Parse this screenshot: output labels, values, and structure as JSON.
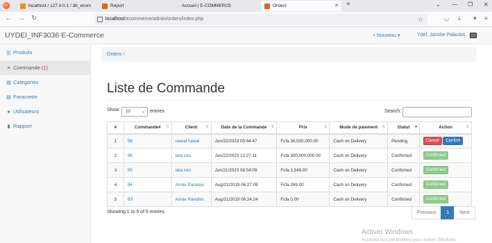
{
  "browser": {
    "tabs": [
      {
        "title": "localhost / 127.0.0.1 / db_ecom",
        "active": false
      },
      {
        "title": "Report",
        "active": false
      },
      {
        "title": "Accueil | E-COMMERCE",
        "active": false
      },
      {
        "title": "Orders",
        "active": true
      }
    ],
    "url_host": "localhost",
    "url_path": "/ecommerce/admin/orders/index.php"
  },
  "header": {
    "brand": "UYDEI_INF3036 E-Commerce",
    "nouveau": "+ Nouveau ▾",
    "user": "Ydel, Janobe Palacios"
  },
  "sidebar": {
    "items": [
      {
        "label": "Produits",
        "icon": "bars-icon",
        "glyph": "|||"
      },
      {
        "label": "Commande",
        "count": "(1)",
        "icon": "list-icon",
        "glyph": "≡"
      },
      {
        "label": "Categories",
        "icon": "list-alt-icon",
        "glyph": "▤"
      },
      {
        "label": "Parametre",
        "icon": "list-alt-icon",
        "glyph": "▤"
      },
      {
        "label": "Utilisateurs",
        "icon": "user-icon",
        "glyph": "●"
      },
      {
        "label": "Rapport",
        "icon": "report-icon",
        "glyph": "▮"
      }
    ]
  },
  "breadcrumb": {
    "link": "Orders",
    "sep": " /"
  },
  "page_title": "Liste de Commande",
  "controls": {
    "show": "Show",
    "page_size": "10",
    "entries": "entries",
    "search_label": "Search:"
  },
  "table": {
    "headers": [
      "#",
      "Commande#",
      "Client",
      "Date de la Commande",
      "Prix",
      "Mode de paiement",
      "Statut",
      "Action"
    ],
    "rows": [
      {
        "n": "1",
        "order": "98",
        "client": "nawal nawal",
        "date": "Jun/22/2023 05:44:47",
        "price": "Fcfa 38,500,000.00",
        "payment": "Cash on Delivery",
        "status": "Pending",
        "actions": [
          "Cancel",
          "Confirm"
        ]
      },
      {
        "n": "2",
        "order": "96",
        "client": "tata toto",
        "date": "Jun/22/2023 12:27:11",
        "price": "Fcfa 300,000,000.00",
        "payment": "Cash on Delivery",
        "status": "Confirmed",
        "actions": [
          "Confirmed"
        ]
      },
      {
        "n": "3",
        "order": "95",
        "client": "tata toto",
        "date": "Jun/21/2023 08:54:09",
        "price": "Fcfa 1,548.00",
        "payment": "Cash on Delivery",
        "status": "Confirmed",
        "actions": [
          "Confirmed"
        ]
      },
      {
        "n": "4",
        "order": "94",
        "client": "Annie Paredes",
        "date": "Aug/21/2019 06:27:09",
        "price": "Fcfa 269.00",
        "payment": "Cash on Delivery",
        "status": "Confirmed",
        "actions": [
          "Confirmed"
        ]
      },
      {
        "n": "5",
        "order": "93",
        "client": "Annie Paredes",
        "date": "Aug/21/2019 06:24:24",
        "price": "Fcfa 0.00",
        "payment": "Cash on Delivery",
        "status": "Confirmed",
        "actions": [
          "Confirmed"
        ]
      }
    ]
  },
  "footer": {
    "showing": "Showing 1 to 5 of 5 entries",
    "previous": "Previous",
    "page": "1",
    "next": "Next"
  },
  "watermark": {
    "title": "Activer Windows",
    "subtitle": "Accédez aux paramètres pour activer Windows."
  },
  "colors": {
    "link": "#337ab7",
    "danger": "#d9534f",
    "success": "#5cb85c",
    "count": "#c9302c"
  }
}
